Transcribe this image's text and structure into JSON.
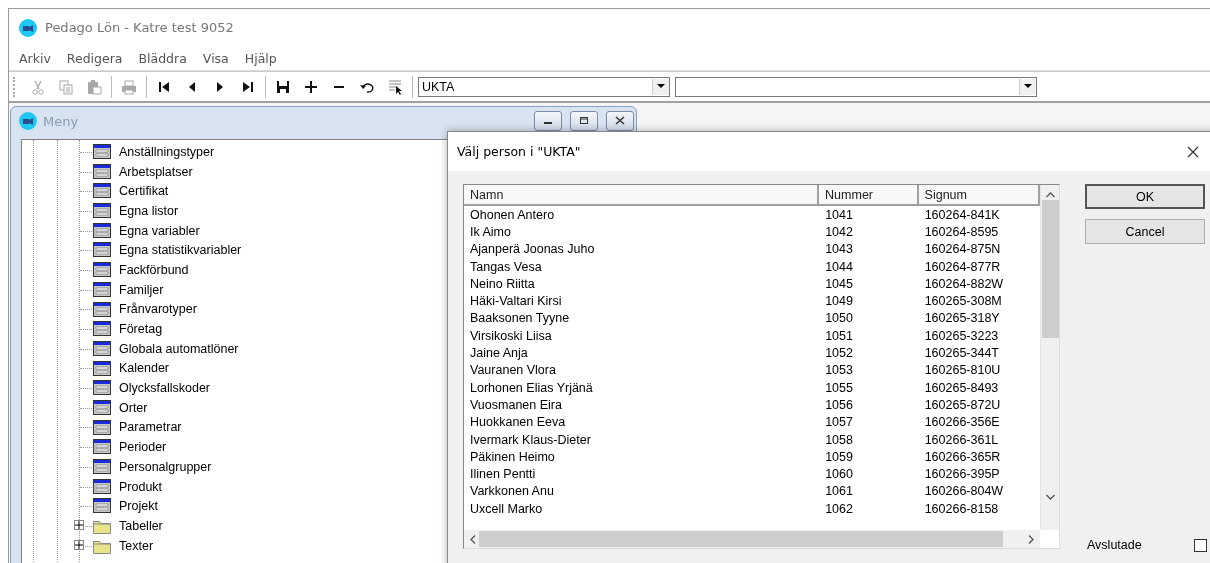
{
  "window": {
    "title": "Pedago Lön - Katre test 9052"
  },
  "menu": [
    "Arkiv",
    "Redigera",
    "Bläddra",
    "Visa",
    "Hjälp"
  ],
  "toolbar": [
    {
      "kind": "cut",
      "disabled": true
    },
    {
      "kind": "copy",
      "disabled": true
    },
    {
      "kind": "paste",
      "disabled": true
    },
    {
      "kind": "separator"
    },
    {
      "kind": "print",
      "disabled": true
    },
    {
      "kind": "separator"
    },
    {
      "kind": "first",
      "disabled": false
    },
    {
      "kind": "previous",
      "disabled": false
    },
    {
      "kind": "next",
      "disabled": false
    },
    {
      "kind": "last",
      "disabled": false
    },
    {
      "kind": "separator"
    },
    {
      "kind": "save",
      "disabled": false
    },
    {
      "kind": "add",
      "disabled": false
    },
    {
      "kind": "remove",
      "disabled": false
    },
    {
      "kind": "undo",
      "disabled": false
    },
    {
      "kind": "select",
      "disabled": false
    },
    {
      "kind": "separator"
    }
  ],
  "table_selector": {
    "value": "UKTA"
  },
  "menu_window": {
    "title": "Meny",
    "items": [
      {
        "kind": "form",
        "label": "Anställningstyper"
      },
      {
        "kind": "form",
        "label": "Arbetsplatser"
      },
      {
        "kind": "form",
        "label": "Certifikat"
      },
      {
        "kind": "form",
        "label": "Egna listor"
      },
      {
        "kind": "form",
        "label": "Egna variabler"
      },
      {
        "kind": "form",
        "label": "Egna statistikvariabler"
      },
      {
        "kind": "form",
        "label": "Fackförbund"
      },
      {
        "kind": "form",
        "label": "Familjer"
      },
      {
        "kind": "form",
        "label": "Frånvarotyper"
      },
      {
        "kind": "form",
        "label": "Företag"
      },
      {
        "kind": "form",
        "label": "Globala automatlöner"
      },
      {
        "kind": "form",
        "label": "Kalender"
      },
      {
        "kind": "form",
        "label": "Olycksfallskoder"
      },
      {
        "kind": "form",
        "label": "Orter"
      },
      {
        "kind": "form",
        "label": "Parametrar"
      },
      {
        "kind": "form",
        "label": "Perioder"
      },
      {
        "kind": "form",
        "label": "Personalgrupper"
      },
      {
        "kind": "form",
        "label": "Produkt"
      },
      {
        "kind": "form",
        "label": "Projekt"
      },
      {
        "kind": "folder",
        "label": "Tabeller",
        "expanded": false
      },
      {
        "kind": "folder",
        "label": "Texter",
        "expanded": false
      }
    ]
  },
  "dialog": {
    "title": "Välj person i \"UKTA\"",
    "columns": [
      "Namn",
      "Nummer",
      "Signum"
    ],
    "rows": [
      {
        "cells": [
          "Ohonen Antero",
          "1041",
          "160264-841K"
        ],
        "selected": false
      },
      {
        "cells": [
          "Ik Aimo",
          "1042",
          "160264-8595"
        ],
        "selected": false
      },
      {
        "cells": [
          "Ajanperä Joonas Juho",
          "1043",
          "160264-875N"
        ],
        "selected": false
      },
      {
        "cells": [
          "Tangas Vesa",
          "1044",
          "160264-877R"
        ],
        "selected": false
      },
      {
        "cells": [
          "Neino Riitta",
          "1045",
          "160264-882W"
        ],
        "selected": false
      },
      {
        "cells": [
          "Häki-Valtari Kirsi",
          "1049",
          "160265-308M"
        ],
        "selected": false
      },
      {
        "cells": [
          "Baaksonen Tyyne",
          "1050",
          "160265-318Y"
        ],
        "selected": false
      },
      {
        "cells": [
          "Virsikoski Liisa",
          "1051",
          "160265-3223"
        ],
        "selected": false
      },
      {
        "cells": [
          "Jaine Anja",
          "1052",
          "160265-344T"
        ],
        "selected": false
      },
      {
        "cells": [
          "Vauranen Vlora",
          "1053",
          "160265-810U"
        ],
        "selected": false
      },
      {
        "cells": [
          "Lorhonen Elias Yrjänä",
          "1055",
          "160265-8493"
        ],
        "selected": false
      },
      {
        "cells": [
          "Vuosmanen Eira",
          "1056",
          "160265-872U"
        ],
        "selected": false
      },
      {
        "cells": [
          "Huokkanen Eeva",
          "1057",
          "160266-356E"
        ],
        "selected": false
      },
      {
        "cells": [
          "Ivermark Klaus-Dieter",
          "1058",
          "160266-361L"
        ],
        "selected": false
      },
      {
        "cells": [
          "Päkinen Heimo",
          "1059",
          "160266-365R"
        ],
        "selected": false
      },
      {
        "cells": [
          "Ilinen Pentti",
          "1060",
          "160266-395P"
        ],
        "selected": false
      },
      {
        "cells": [
          "Varkkonen Anu",
          "1061",
          "160266-804W"
        ],
        "selected": false
      },
      {
        "cells": [
          "Uxcell Marko",
          "1062",
          "160266-8158"
        ],
        "selected": false
      }
    ],
    "buttons": [
      {
        "label": "OK",
        "default": true
      },
      {
        "label": "Cancel",
        "default": false
      }
    ],
    "checkbox": {
      "label": "Avslutade",
      "checked": false
    }
  }
}
